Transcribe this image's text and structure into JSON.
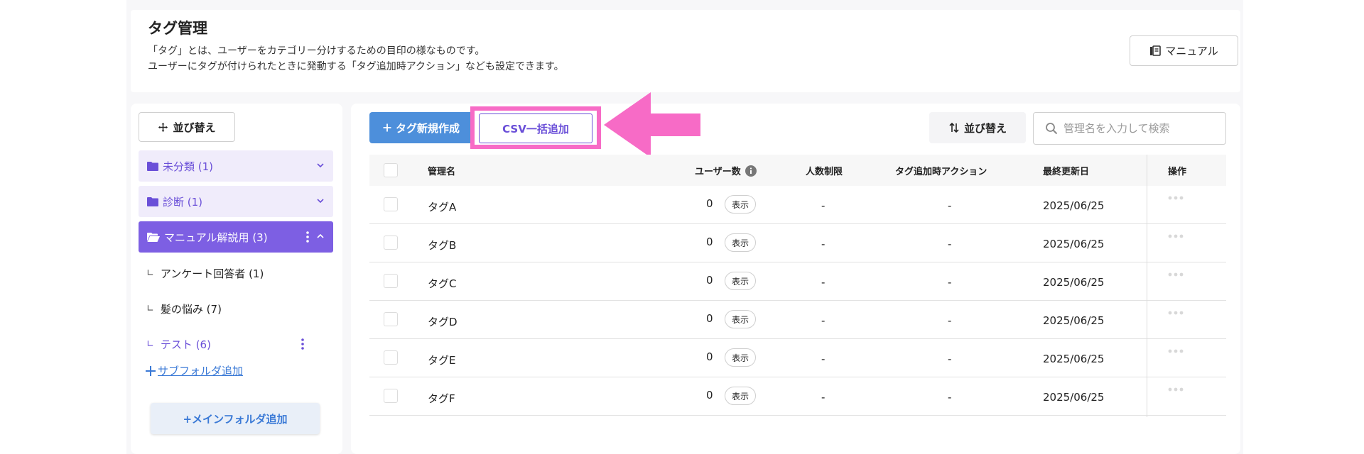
{
  "header": {
    "title": "タグ管理",
    "description_line1": "「タグ」とは、ユーザーをカテゴリー分けするための目印の様なものです。",
    "description_line2": "ユーザーにタグが付けられたときに発動する「タグ追加時アクション」なども設定できます。",
    "manual_label": "マニュアル"
  },
  "sidebar": {
    "sort_label": "並び替え",
    "folders": [
      {
        "label": "未分類 (1)",
        "state": "collapsed"
      },
      {
        "label": "診断 (1)",
        "state": "collapsed"
      },
      {
        "label": "マニュアル解説用 (3)",
        "state": "expanded-active"
      }
    ],
    "subfolders": [
      {
        "label": "アンケート回答者 (1)"
      },
      {
        "label": "髪の悩み (7)"
      },
      {
        "label": "テスト (6)"
      }
    ],
    "add_subfolder_label": "サブフォルダ追加",
    "add_main_folder_label": "+メインフォルダ追加"
  },
  "toolbar": {
    "new_tag_label": "タグ新規作成",
    "csv_label": "CSV一括追加",
    "sort_label": "並び替え",
    "search_placeholder": "管理名を入力して検索"
  },
  "table": {
    "columns": [
      "管理名",
      "ユーザー数",
      "人数制限",
      "タグ追加時アクション",
      "最終更新日",
      "操作"
    ],
    "show_label": "表示",
    "rows": [
      {
        "name": "タグA",
        "users": "0",
        "limit": "-",
        "action": "-",
        "updated": "2025/06/25"
      },
      {
        "name": "タグB",
        "users": "0",
        "limit": "-",
        "action": "-",
        "updated": "2025/06/25"
      },
      {
        "name": "タグC",
        "users": "0",
        "limit": "-",
        "action": "-",
        "updated": "2025/06/25"
      },
      {
        "name": "タグD",
        "users": "0",
        "limit": "-",
        "action": "-",
        "updated": "2025/06/25"
      },
      {
        "name": "タグE",
        "users": "0",
        "limit": "-",
        "action": "-",
        "updated": "2025/06/25"
      },
      {
        "name": "タグF",
        "users": "0",
        "limit": "-",
        "action": "-",
        "updated": "2025/06/25"
      }
    ]
  },
  "colors": {
    "accent_purple": "#7d5fe3",
    "primary_blue": "#4d8fdb",
    "highlight_pink": "#f76bc6"
  },
  "icons": [
    "book-icon",
    "move-icon",
    "folder-icon",
    "folder-open-icon",
    "chevron-down-icon",
    "chevron-up-icon",
    "kebab-icon",
    "plus-icon",
    "sort-icon",
    "search-icon",
    "info-icon",
    "more-dots-icon",
    "arrow-icon"
  ]
}
